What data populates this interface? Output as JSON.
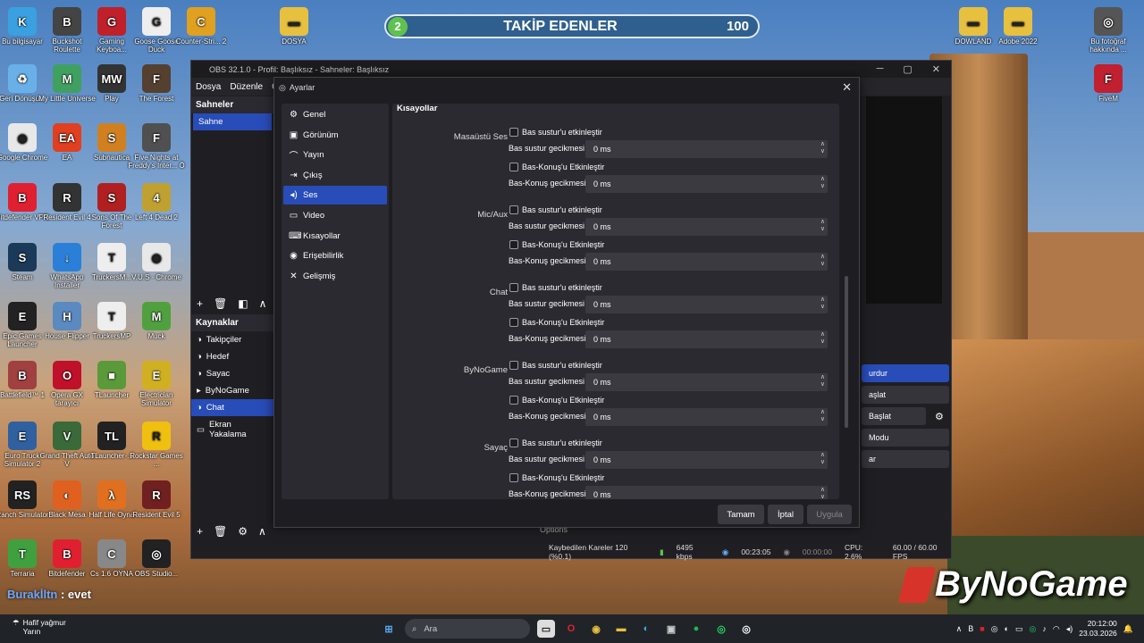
{
  "desktop_icons": [
    {
      "label": "Bu bilgisayar",
      "color": "#3aa0e0",
      "glyph": "K"
    },
    {
      "label": "Buckshot Roulette",
      "color": "#444",
      "glyph": "B"
    },
    {
      "label": "Gaming Keyboa...",
      "color": "#c0202a",
      "glyph": "G"
    },
    {
      "label": "Goose Goose Duck",
      "color": "#eee",
      "glyph": "G"
    },
    {
      "label": "Counter-Stri... 2",
      "color": "#e0a020",
      "glyph": "C"
    },
    {
      "label": "DOSYA",
      "color": "#e8c040",
      "glyph": "▬"
    },
    {
      "label": "Geri Dönüşü...",
      "color": "#6ab0e8",
      "glyph": "♻"
    },
    {
      "label": "My Little Universe",
      "color": "#40a060",
      "glyph": "M"
    },
    {
      "label": "Play",
      "color": "#333",
      "glyph": "MW"
    },
    {
      "label": "The Forest",
      "color": "#554030",
      "glyph": "F"
    },
    {
      "label": "Google Chrome",
      "color": "#e8e8e8",
      "glyph": "◉"
    },
    {
      "label": "EA",
      "color": "#e04020",
      "glyph": "EA"
    },
    {
      "label": "Subnautica",
      "color": "#d08020",
      "glyph": "S"
    },
    {
      "label": "Five Nights at Freddy's Inter... Ō",
      "color": "#505050",
      "glyph": "F"
    },
    {
      "label": "Bitdefender VPN",
      "color": "#e02030",
      "glyph": "B"
    },
    {
      "label": "Resident Evil 4",
      "color": "#333",
      "glyph": "R"
    },
    {
      "label": "Sons Of The Forest",
      "color": "#b02020",
      "glyph": "S"
    },
    {
      "label": "Left 4 Dead 2",
      "color": "#c0a030",
      "glyph": "4"
    },
    {
      "label": "Steam",
      "color": "#1b3a5a",
      "glyph": "S"
    },
    {
      "label": "WhatsApp Installer",
      "color": "#2a80d8",
      "glyph": "↓"
    },
    {
      "label": "TruckersM...",
      "color": "#eee",
      "glyph": "T"
    },
    {
      "label": "V.U.S - Chrome",
      "color": "#e8e8e8",
      "glyph": "◉"
    },
    {
      "label": "Epic Games Launcher",
      "color": "#222",
      "glyph": "E"
    },
    {
      "label": "House Flipper",
      "color": "#5a8ac0",
      "glyph": "H"
    },
    {
      "label": "TruckersMP",
      "color": "#eee",
      "glyph": "T"
    },
    {
      "label": "Muck",
      "color": "#50a040",
      "glyph": "M"
    },
    {
      "label": "Battlefield™ 1",
      "color": "#a04040",
      "glyph": "B"
    },
    {
      "label": "Opera GX tarayıcı",
      "color": "#c0102a",
      "glyph": "O"
    },
    {
      "label": "TLauncher",
      "color": "#5a9a3a",
      "glyph": "■"
    },
    {
      "label": "Electrician Simulator",
      "color": "#d0b020",
      "glyph": "E"
    },
    {
      "label": "Euro Truck Simulator 2",
      "color": "#3060a0",
      "glyph": "E"
    },
    {
      "label": "Grand Theft Auto V",
      "color": "#3a6a3a",
      "glyph": "V"
    },
    {
      "label": "TLauncher-...",
      "color": "#222",
      "glyph": "TL"
    },
    {
      "label": "Rockstar Games ...",
      "color": "#f0c010",
      "glyph": "R"
    },
    {
      "label": "Ranch Simulator",
      "color": "#222",
      "glyph": "RS"
    },
    {
      "label": "Black Mesa",
      "color": "#e06020",
      "glyph": "◐"
    },
    {
      "label": "Half Life Oyna",
      "color": "#e07020",
      "glyph": "λ"
    },
    {
      "label": "Resident Evil 5",
      "color": "#702020",
      "glyph": "R"
    },
    {
      "label": "Terraria",
      "color": "#40a040",
      "glyph": "T"
    },
    {
      "label": "Bitdefender",
      "color": "#e02030",
      "glyph": "B"
    },
    {
      "label": "Cs 1.6 OYNA",
      "color": "#888",
      "glyph": "C"
    },
    {
      "label": "OBS Studio...",
      "color": "#222",
      "glyph": "◎"
    },
    {
      "label": "DOWLAND",
      "color": "#e8c040",
      "glyph": "▬"
    },
    {
      "label": "Adobe 2022",
      "color": "#e8c040",
      "glyph": "▬"
    },
    {
      "label": "Bu fotoğraf hakkında ...",
      "color": "#555",
      "glyph": "◎"
    },
    {
      "label": "FiveM",
      "color": "#c02030",
      "glyph": "F"
    }
  ],
  "follow_bar": {
    "step": "2",
    "title": "TAKİP EDENLER",
    "value": "100"
  },
  "obs": {
    "title": "OBS 32.1.0 - Profil: Başlıksız - Sahneler: Başlıksız",
    "menu": [
      "Dosya",
      "Düzenle",
      "Gö"
    ],
    "scenes_header": "Sahneler",
    "scenes": [
      "Sahne"
    ],
    "sources_header": "Kaynaklar",
    "sources": [
      {
        "label": "Takipçiler",
        "icon": "◑"
      },
      {
        "label": "Hedef",
        "icon": "◑"
      },
      {
        "label": "Sayac",
        "icon": "◑"
      },
      {
        "label": "ByNoGame",
        "icon": "▸"
      },
      {
        "label": "Chat",
        "icon": "◑"
      },
      {
        "label": "Ekran Yakalama",
        "icon": "▭"
      }
    ],
    "controls": [
      "urdur",
      "aşlat",
      "Başlat",
      "Modu",
      "ar"
    ],
    "status": {
      "dropped": "Kaybedilen Kareler 120 (%0.1)",
      "bitrate": "6495 kbps",
      "time1": "00:23:05",
      "time2": "00:00:00",
      "cpu": "CPU: 2.6%",
      "fps": "60.00 / 60.00 FPS"
    },
    "mixer_label": "Options"
  },
  "settings": {
    "title": "Ayarlar",
    "nav": [
      {
        "label": "Genel",
        "icon": "⚙"
      },
      {
        "label": "Görünüm",
        "icon": "▣"
      },
      {
        "label": "Yayın",
        "icon": "⌒"
      },
      {
        "label": "Çıkış",
        "icon": "⇥"
      },
      {
        "label": "Ses",
        "icon": "◂)"
      },
      {
        "label": "Video",
        "icon": "▭"
      },
      {
        "label": "Kısayollar",
        "icon": "⌨"
      },
      {
        "label": "Erişebilirlik",
        "icon": "◉"
      },
      {
        "label": "Gelişmiş",
        "icon": "✕"
      }
    ],
    "selected_nav": "Ses",
    "section_title": "Kısayollar",
    "groups": [
      {
        "name": "Masaüstü Ses"
      },
      {
        "name": "Mic/Aux"
      },
      {
        "name": "Chat"
      },
      {
        "name": "ByNoGame"
      },
      {
        "name": "Sayaç"
      }
    ],
    "labels": {
      "mute_enable": "Bas sustur'u etkinleştir",
      "mute_delay": "Bas sustur gecikmesi",
      "ptt_enable": "Bas-Konuş'u Etkinleştir",
      "ptt_delay": "Bas-Konuş gecikmesi",
      "delay_value": "0 ms"
    },
    "buttons": {
      "ok": "Tamam",
      "cancel": "İptal",
      "apply": "Uygula"
    }
  },
  "chat_overlay": {
    "user": "Burakİltn",
    "message": " : evet"
  },
  "brand_logo": "ByNoGame",
  "taskbar": {
    "weather_line1": "Hafif yağmur",
    "weather_line2": "Yarın",
    "search_placeholder": "Ara",
    "time": "20:12:00",
    "date": "23.03.2026"
  }
}
